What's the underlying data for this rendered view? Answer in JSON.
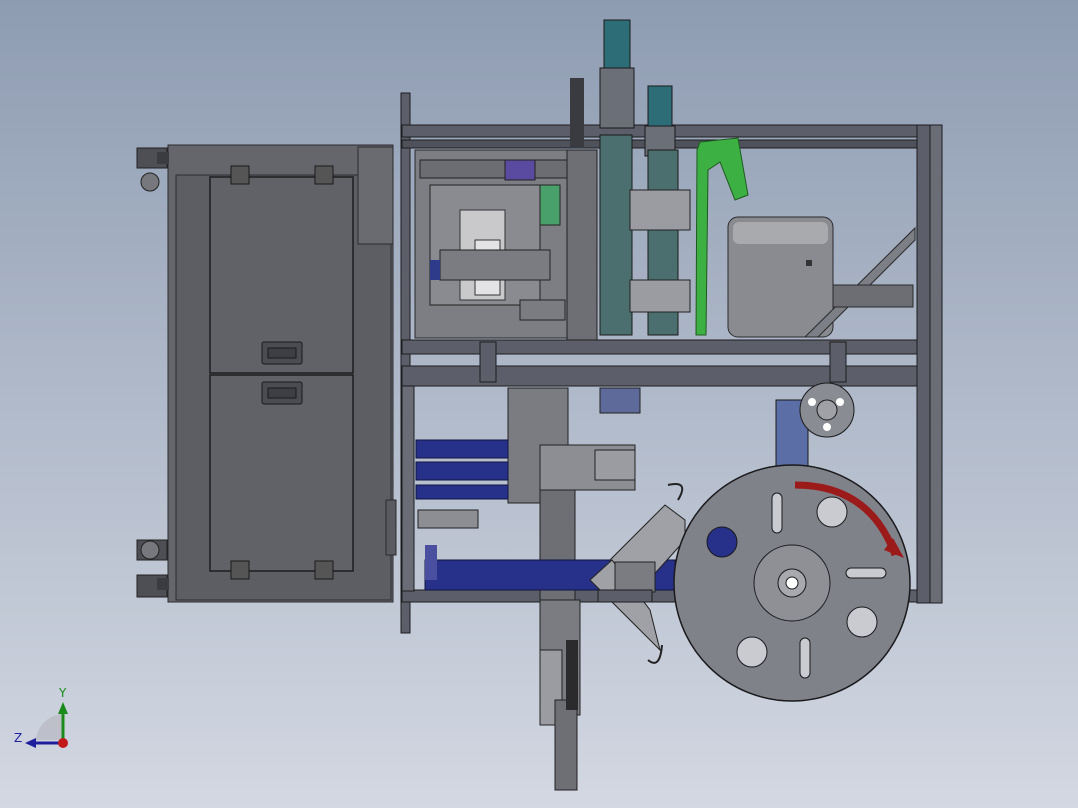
{
  "viewport": {
    "background_top": "#8e9cb2",
    "background_bottom": "#d3d8e2"
  },
  "triad": {
    "y_label": "Y",
    "z_label": "Z",
    "y_color": "#1a8a1a",
    "z_color": "#1f1f9e",
    "origin_color": "#c21a1a"
  },
  "model": {
    "frame_color": "#5b5f6a",
    "panel_color": "#6f7076",
    "accent_teal": "#2d6d78",
    "accent_blue": "#27318a",
    "accent_green": "#3cb043",
    "arrow_red": "#9b1b1b"
  }
}
